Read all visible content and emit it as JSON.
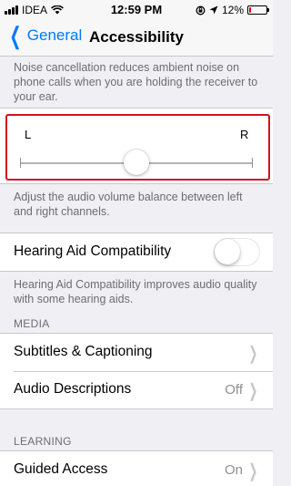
{
  "status_bar": {
    "carrier": "IDEA",
    "time": "12:59 PM",
    "battery_percent": "12%",
    "battery_level": 0.12,
    "battery_color": "#e00000",
    "icons": [
      "signal-icon",
      "wifi-icon",
      "rotation-lock-icon",
      "location-icon",
      "battery-icon"
    ]
  },
  "nav": {
    "back_label": "General",
    "title": "Accessibility",
    "accent": "#007aff"
  },
  "noise_footer": "Noise cancellation reduces ambient noise on phone calls when you are holding the receiver to your ear.",
  "balance": {
    "left_label": "L",
    "right_label": "R",
    "value": 0.5,
    "footer": "Adjust the audio volume balance between left and right channels.",
    "highlight_color": "#d0121e"
  },
  "hearing_aid": {
    "label": "Hearing Aid Compatibility",
    "enabled": false,
    "footer": "Hearing Aid Compatibility improves audio quality with some hearing aids."
  },
  "media": {
    "header": "MEDIA",
    "items": [
      {
        "label": "Subtitles & Captioning",
        "value": ""
      },
      {
        "label": "Audio Descriptions",
        "value": "Off"
      }
    ]
  },
  "learning": {
    "header": "LEARNING",
    "items": [
      {
        "label": "Guided Access",
        "value": "On"
      }
    ]
  }
}
